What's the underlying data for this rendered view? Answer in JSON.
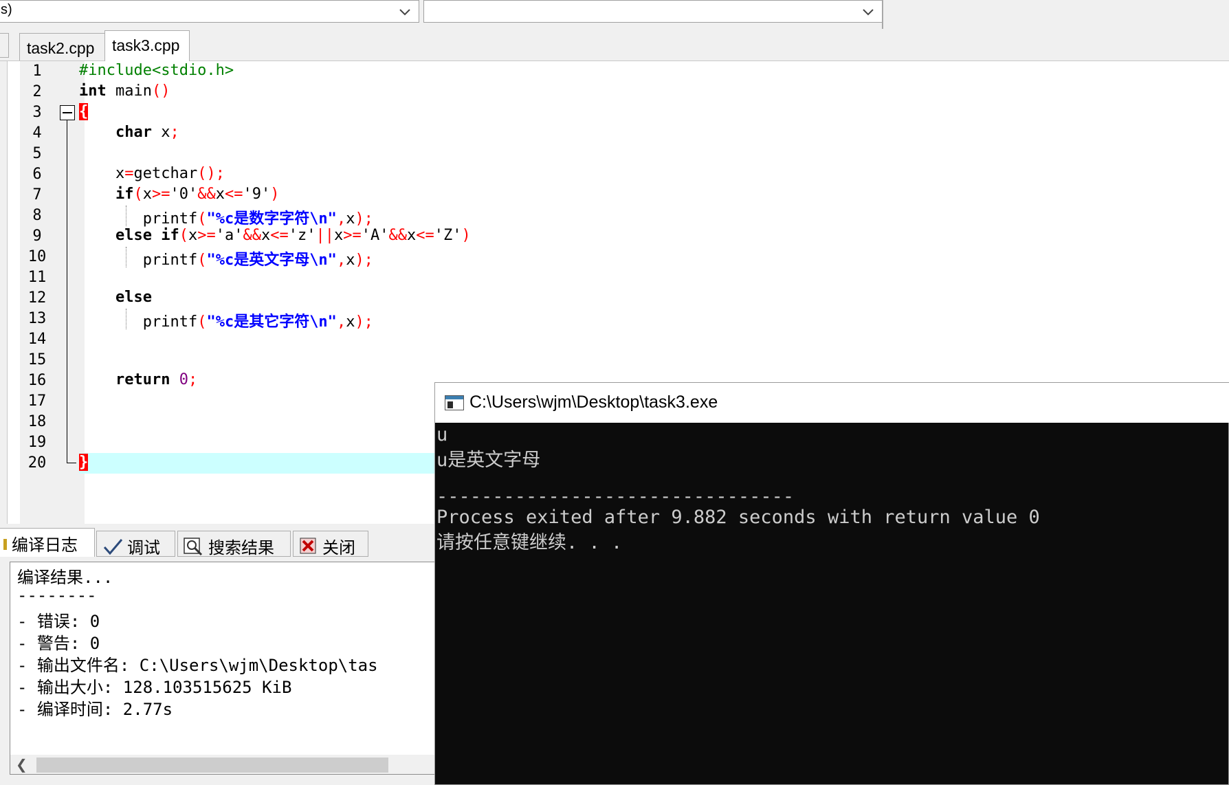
{
  "toolbar": {
    "combo_left_value": "s)",
    "combo_right_value": ""
  },
  "tabs": [
    {
      "label": "task2.cpp",
      "active": false
    },
    {
      "label": "task3.cpp",
      "active": true
    }
  ],
  "editor": {
    "line_numbers": [
      "1",
      "2",
      "3",
      "4",
      "5",
      "6",
      "7",
      "8",
      "9",
      "10",
      "11",
      "12",
      "13",
      "14",
      "15",
      "16",
      "17",
      "18",
      "19",
      "20"
    ],
    "code": {
      "l1_include": "#include<stdio.h>",
      "l2_int": "int",
      "l2_main": " main",
      "l2_paren": "()",
      "l3_brace": "{",
      "l4_char": "char",
      "l4_x": " x",
      "l4_semi": ";",
      "l6_x": "x",
      "l6_eq": "=",
      "l6_getchar": "getchar",
      "l6_rest": "();",
      "l7_if": "if",
      "l7_p1": "(",
      "l7_x1": "x",
      "l7_ge": ">=",
      "l7_c0": "'0'",
      "l7_and": "&&",
      "l7_x2": "x",
      "l7_le": "<=",
      "l7_c9": "'9'",
      "l7_p2": ")",
      "printf": "printf",
      "l8_open": "(",
      "l8_str": "\"%c是数字字符\\n\"",
      "l8_comma": ",",
      "l8_x": "x",
      "l8_close": ");",
      "l9_else": "else",
      "l9_if": " if",
      "l9_p1": "(",
      "l9_x1": "x",
      "l9_ge1": ">=",
      "l9_ca": "'a'",
      "l9_and1": "&&",
      "l9_x2": "x",
      "l9_le1": "<=",
      "l9_cz": "'z'",
      "l9_or": "||",
      "l9_x3": "x",
      "l9_ge2": ">=",
      "l9_cA": "'A'",
      "l9_and2": "&&",
      "l9_x4": "x",
      "l9_le2": "<=",
      "l9_cZ": "'Z'",
      "l9_p2": ")",
      "l10_str": "\"%c是英文字母\\n\"",
      "l12_else": "else",
      "l13_str": "\"%c是其它字符\\n\"",
      "l16_return": "return",
      "l16_zero": "0",
      "l16_semi": ";",
      "l20_brace": "}"
    }
  },
  "bottom_panel": {
    "tabs": [
      {
        "label": "编译日志",
        "icon": "compile-log-icon"
      },
      {
        "label": "调试",
        "icon": "check-icon"
      },
      {
        "label": "搜索结果",
        "icon": "search-icon"
      },
      {
        "label": "关闭",
        "icon": "close-icon"
      }
    ],
    "log_lines": [
      "编译结果...",
      "--------",
      "- 错误: 0",
      "- 警告: 0",
      "- 输出文件名: C:\\Users\\wjm\\Desktop\\tas",
      "- 输出大小: 128.103515625 KiB",
      "- 编译时间: 2.77s"
    ]
  },
  "console": {
    "title": "C:\\Users\\wjm\\Desktop\\task3.exe",
    "lines": [
      "u",
      "u是英文字母",
      "",
      "--------------------------------",
      "Process exited after 9.882 seconds with return value 0",
      "请按任意键继续. . ."
    ]
  }
}
